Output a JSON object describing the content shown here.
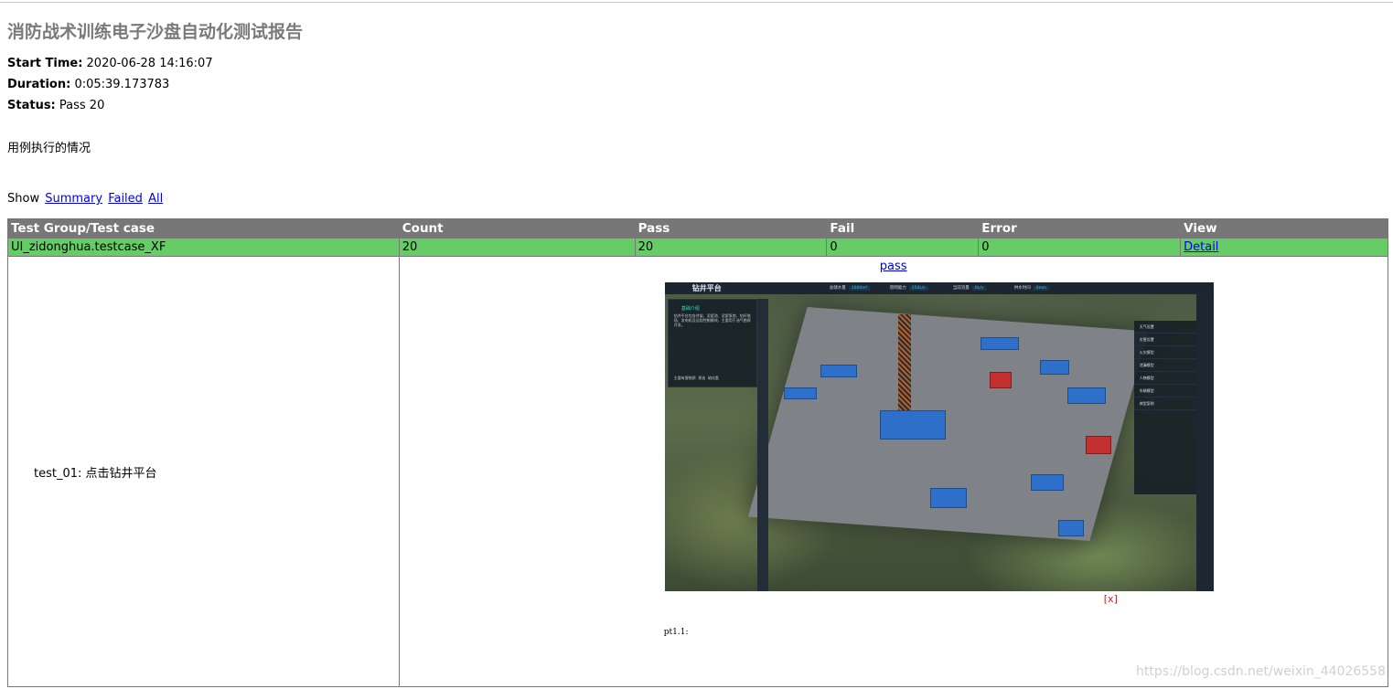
{
  "report": {
    "title": "消防战术训练电子沙盘自动化测试报告",
    "start_time_label": "Start Time:",
    "start_time": "2020-06-28 14:16:07",
    "duration_label": "Duration:",
    "duration": "0:05:39.173783",
    "status_label": "Status:",
    "status": "Pass 20",
    "description": "用例执行的情况"
  },
  "filter": {
    "label": "Show",
    "options": [
      "Summary",
      "Failed",
      "All"
    ]
  },
  "table": {
    "headers": [
      "Test Group/Test case",
      "Count",
      "Pass",
      "Fail",
      "Error",
      "View"
    ],
    "group": {
      "name": "UI_zidonghua.testcase_XF",
      "count": "20",
      "pass": "20",
      "fail": "0",
      "error": "0",
      "view": "Detail"
    },
    "case": {
      "name": "test_01: 点击钻井平台",
      "status_link": "pass",
      "close": "[x]",
      "log": "pt1.1:"
    },
    "header_bg": "#777777",
    "pass_bg": "#66cc66"
  },
  "screenshot": {
    "app_title": "钻井平台",
    "stats": [
      {
        "label": "总储水量",
        "value": "1000m³"
      },
      {
        "label": "管网能力",
        "value": "250L/s"
      },
      {
        "label": "当前流量",
        "value": "0L/s"
      },
      {
        "label": "供水时间",
        "value": "0min"
      }
    ],
    "left_panel_title": "基础介绍",
    "left_panel_text": "钻井平台包含井架、泥浆池、泥浆泵房、钻杆堆场、发电机及远程控制模块，主要用于油气勘探开发。",
    "left_panel_tabs": [
      "主要有害物质",
      "原油",
      "硫化氢"
    ],
    "right_panel_items": [
      "天气设置",
      "灾害设置",
      "火灾模型",
      "泄漏模型",
      "人物模型",
      "车辆模型",
      "典型案例"
    ]
  },
  "watermark": "https://blog.csdn.net/weixin_44026558"
}
